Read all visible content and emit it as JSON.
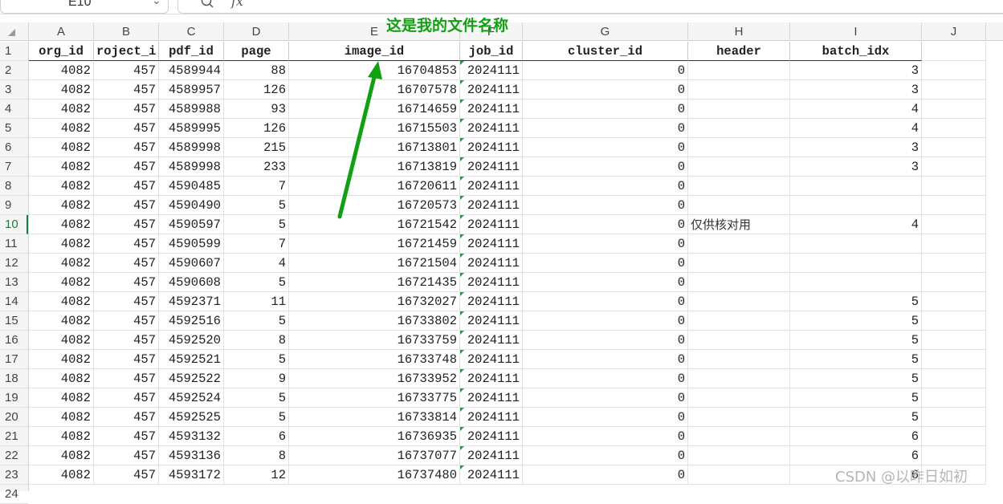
{
  "formula_bar": {
    "name_box": "E10",
    "fx": "fx"
  },
  "columns": [
    "A",
    "B",
    "C",
    "D",
    "E",
    "F",
    "G",
    "H",
    "I",
    "J"
  ],
  "headers": [
    "org_id",
    "roject_i",
    "pdf_id",
    "page",
    "image_id",
    "job_id",
    "cluster_id",
    "header",
    "batch_idx"
  ],
  "rows": [
    [
      "4082",
      "457",
      "4589944",
      "88",
      "16704853",
      "2024111",
      "0",
      "",
      "3"
    ],
    [
      "4082",
      "457",
      "4589957",
      "126",
      "16707578",
      "2024111",
      "0",
      "",
      "3"
    ],
    [
      "4082",
      "457",
      "4589988",
      "93",
      "16714659",
      "2024111",
      "0",
      "",
      "4"
    ],
    [
      "4082",
      "457",
      "4589995",
      "126",
      "16715503",
      "2024111",
      "0",
      "",
      "4"
    ],
    [
      "4082",
      "457",
      "4589998",
      "215",
      "16713801",
      "2024111",
      "0",
      "",
      "3"
    ],
    [
      "4082",
      "457",
      "4589998",
      "233",
      "16713819",
      "2024111",
      "0",
      "",
      "3"
    ],
    [
      "4082",
      "457",
      "4590485",
      "7",
      "16720611",
      "2024111",
      "0",
      "",
      ""
    ],
    [
      "4082",
      "457",
      "4590490",
      "5",
      "16720573",
      "2024111",
      "0",
      "",
      ""
    ],
    [
      "4082",
      "457",
      "4590597",
      "5",
      "16721542",
      "2024111",
      "0",
      "仅供核对用",
      "4"
    ],
    [
      "4082",
      "457",
      "4590599",
      "7",
      "16721459",
      "2024111",
      "0",
      "",
      ""
    ],
    [
      "4082",
      "457",
      "4590607",
      "4",
      "16721504",
      "2024111",
      "0",
      "",
      ""
    ],
    [
      "4082",
      "457",
      "4590608",
      "5",
      "16721435",
      "2024111",
      "0",
      "",
      ""
    ],
    [
      "4082",
      "457",
      "4592371",
      "11",
      "16732027",
      "2024111",
      "0",
      "",
      "5"
    ],
    [
      "4082",
      "457",
      "4592516",
      "5",
      "16733802",
      "2024111",
      "0",
      "",
      "5"
    ],
    [
      "4082",
      "457",
      "4592520",
      "8",
      "16733759",
      "2024111",
      "0",
      "",
      "5"
    ],
    [
      "4082",
      "457",
      "4592521",
      "5",
      "16733748",
      "2024111",
      "0",
      "",
      "5"
    ],
    [
      "4082",
      "457",
      "4592522",
      "9",
      "16733952",
      "2024111",
      "0",
      "",
      "5"
    ],
    [
      "4082",
      "457",
      "4592524",
      "5",
      "16733775",
      "2024111",
      "0",
      "",
      "5"
    ],
    [
      "4082",
      "457",
      "4592525",
      "5",
      "16733814",
      "2024111",
      "0",
      "",
      "5"
    ],
    [
      "4082",
      "457",
      "4593132",
      "6",
      "16736935",
      "2024111",
      "0",
      "",
      "6"
    ],
    [
      "4082",
      "457",
      "4593136",
      "8",
      "16737077",
      "2024111",
      "0",
      "",
      "6"
    ],
    [
      "4082",
      "457",
      "4593172",
      "12",
      "16737480",
      "2024111",
      "0",
      "",
      "6"
    ]
  ],
  "annotation": {
    "label": "这是我的文件名称",
    "color": "#11a011"
  },
  "watermark": "CSDN @以昨日如初",
  "selected_row": "10",
  "accent": "#1e7b3a"
}
